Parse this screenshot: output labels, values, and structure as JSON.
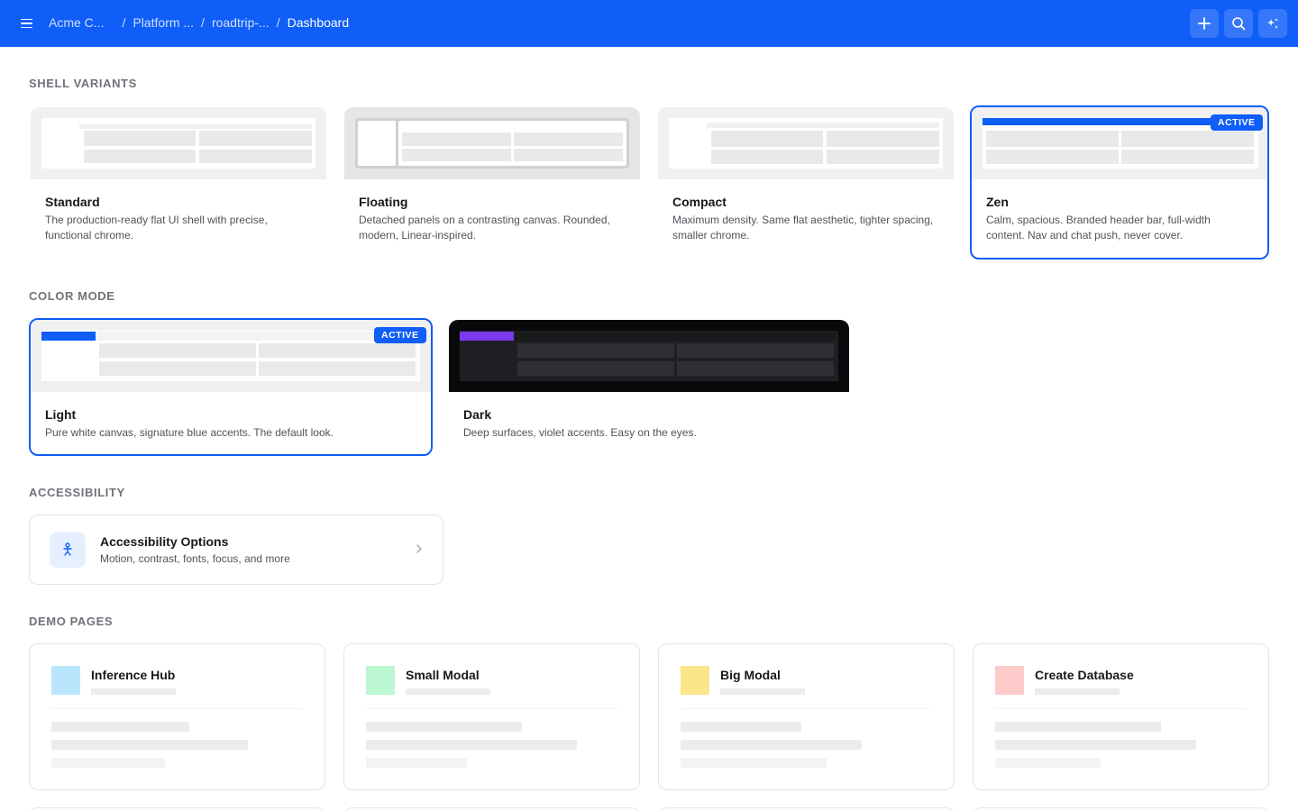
{
  "header": {
    "menu_icon": "hamburger-menu-icon",
    "breadcrumbs": [
      "Acme C...",
      "Platform ...",
      "roadtrip-...",
      "Dashboard"
    ],
    "actions": {
      "add_icon": "plus-icon",
      "search_icon": "search-icon",
      "ai_icon": "sparkle-icon"
    },
    "background_color": "#0f5ef7"
  },
  "sections": {
    "shell_variants": "SHELL VARIANTS",
    "color_mode": "COLOR MODE",
    "accessibility": "ACCESSIBILITY",
    "demo_pages": "DEMO PAGES"
  },
  "shell_variants": [
    {
      "title": "Standard",
      "description": "The production-ready flat UI shell with precise, functional chrome.",
      "active": false
    },
    {
      "title": "Floating",
      "description": "Detached panels on a contrasting canvas. Rounded, modern, Linear-inspired.",
      "active": false
    },
    {
      "title": "Compact",
      "description": "Maximum density. Same flat aesthetic, tighter spacing, smaller chrome.",
      "active": false
    },
    {
      "title": "Zen",
      "description": "Calm, spacious. Branded header bar, full-width content. Nav and chat push, never cover.",
      "active": true
    }
  ],
  "color_modes": [
    {
      "title": "Light",
      "description": "Pure white canvas, signature blue accents. The default look.",
      "active": true,
      "accent": "#0f5ef7"
    },
    {
      "title": "Dark",
      "description": "Deep surfaces, violet accents. Easy on the eyes.",
      "active": false,
      "accent": "#7c3aed"
    }
  ],
  "active_badge": "ACTIVE",
  "accessibility": {
    "icon": "accessibility-person-icon",
    "title": "Accessibility Options",
    "description": "Motion, contrast, fonts, focus, and more",
    "chevron_icon": "chevron-right-icon"
  },
  "demo_pages": [
    {
      "title": "Inference Hub",
      "color": "#bae6fd"
    },
    {
      "title": "Small Modal",
      "color": "#bbf7d0"
    },
    {
      "title": "Big Modal",
      "color": "#fde68a"
    },
    {
      "title": "Create Database",
      "color": "#fecaca"
    }
  ]
}
